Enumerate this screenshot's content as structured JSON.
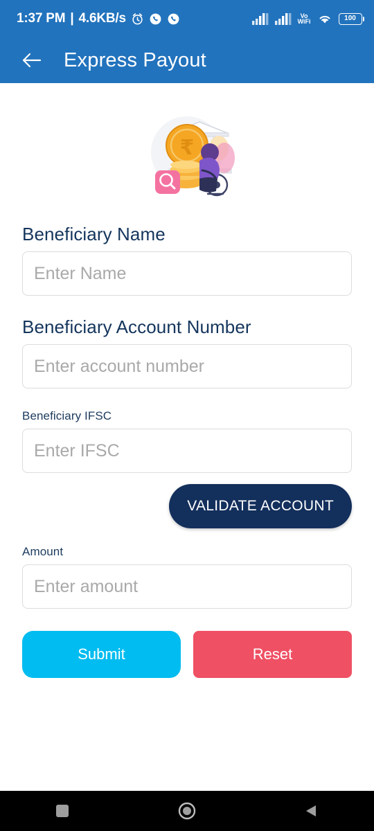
{
  "status_bar": {
    "time": "1:37 PM",
    "separator": "|",
    "network_speed": "4.6KB/s",
    "icons": [
      "alarm-icon",
      "call-icon",
      "call-icon",
      "signal-bars-icon",
      "signal-bars-icon",
      "volte-wifi-icon",
      "wifi-icon",
      "battery-icon"
    ],
    "volte_label_top": "Vo",
    "volte_label_bottom": "WiFi",
    "battery_level": "100",
    "background_color": "#2273bd",
    "text_color": "#ffffff"
  },
  "app_bar": {
    "back_icon": "arrow-left-icon",
    "title": "Express Payout",
    "background_color": "#2273bd",
    "title_color": "#ffffff"
  },
  "hero": {
    "illustration_name": "bank-rupee-payout-illustration",
    "alt": "Bank building with rupee coin, coin stack, magnifier and person in wheelchair",
    "currency_symbol": "₹"
  },
  "form": {
    "fields": [
      {
        "id": "beneficiary-name",
        "label": "Beneficiary Name",
        "label_size": "large",
        "placeholder": "Enter Name",
        "value": ""
      },
      {
        "id": "beneficiary-account-number",
        "label": "Beneficiary Account Number",
        "label_size": "large",
        "placeholder": "Enter account number",
        "value": ""
      },
      {
        "id": "beneficiary-ifsc",
        "label": "Beneficiary IFSC",
        "label_size": "small",
        "placeholder": "Enter IFSC",
        "value": ""
      },
      {
        "id": "amount",
        "label": "Amount",
        "label_size": "small",
        "placeholder": "Enter amount",
        "value": ""
      }
    ],
    "validate_button": {
      "label": "VALIDATE ACCOUNT",
      "background_color": "#132f5c",
      "text_color": "#ffffff"
    },
    "submit_button": {
      "label": "Submit",
      "background_color": "#00bcf0",
      "text_color": "#ffffff"
    },
    "reset_button": {
      "label": "Reset",
      "background_color": "#ef5064",
      "text_color": "#ffffff"
    },
    "label_color": "#14355c",
    "placeholder_color": "#a9a9a9",
    "input_border_color": "#dcdcdc"
  },
  "nav_bar": {
    "background_color": "#000000",
    "buttons": [
      {
        "name": "recents-square-icon"
      },
      {
        "name": "home-circle-icon"
      },
      {
        "name": "back-triangle-icon"
      }
    ]
  }
}
